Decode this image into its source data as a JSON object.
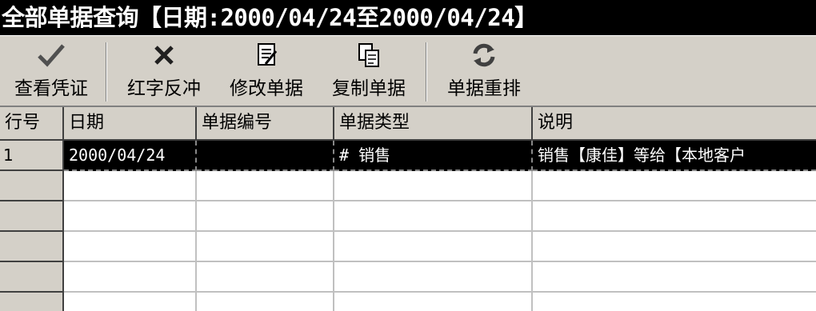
{
  "title": "全部单据查询【日期:2000/04/24至2000/04/24】",
  "toolbar": {
    "buttons": [
      {
        "label": "查看凭证",
        "icon": "checkmark-icon"
      },
      {
        "label": "红字反冲",
        "icon": "x-mark-icon"
      },
      {
        "label": "修改单据",
        "icon": "edit-document-icon"
      },
      {
        "label": "复制单据",
        "icon": "copy-document-icon"
      },
      {
        "label": "单据重排",
        "icon": "refresh-icon"
      }
    ]
  },
  "table": {
    "columns": [
      "行号",
      "日期",
      "单据编号",
      "单据类型",
      "说明"
    ],
    "rows": [
      {
        "row_no": "1",
        "date": "2000/04/24",
        "doc_no": "",
        "doc_type": "# 销售",
        "desc": "销售【康佳】等给【本地客户"
      }
    ]
  }
}
